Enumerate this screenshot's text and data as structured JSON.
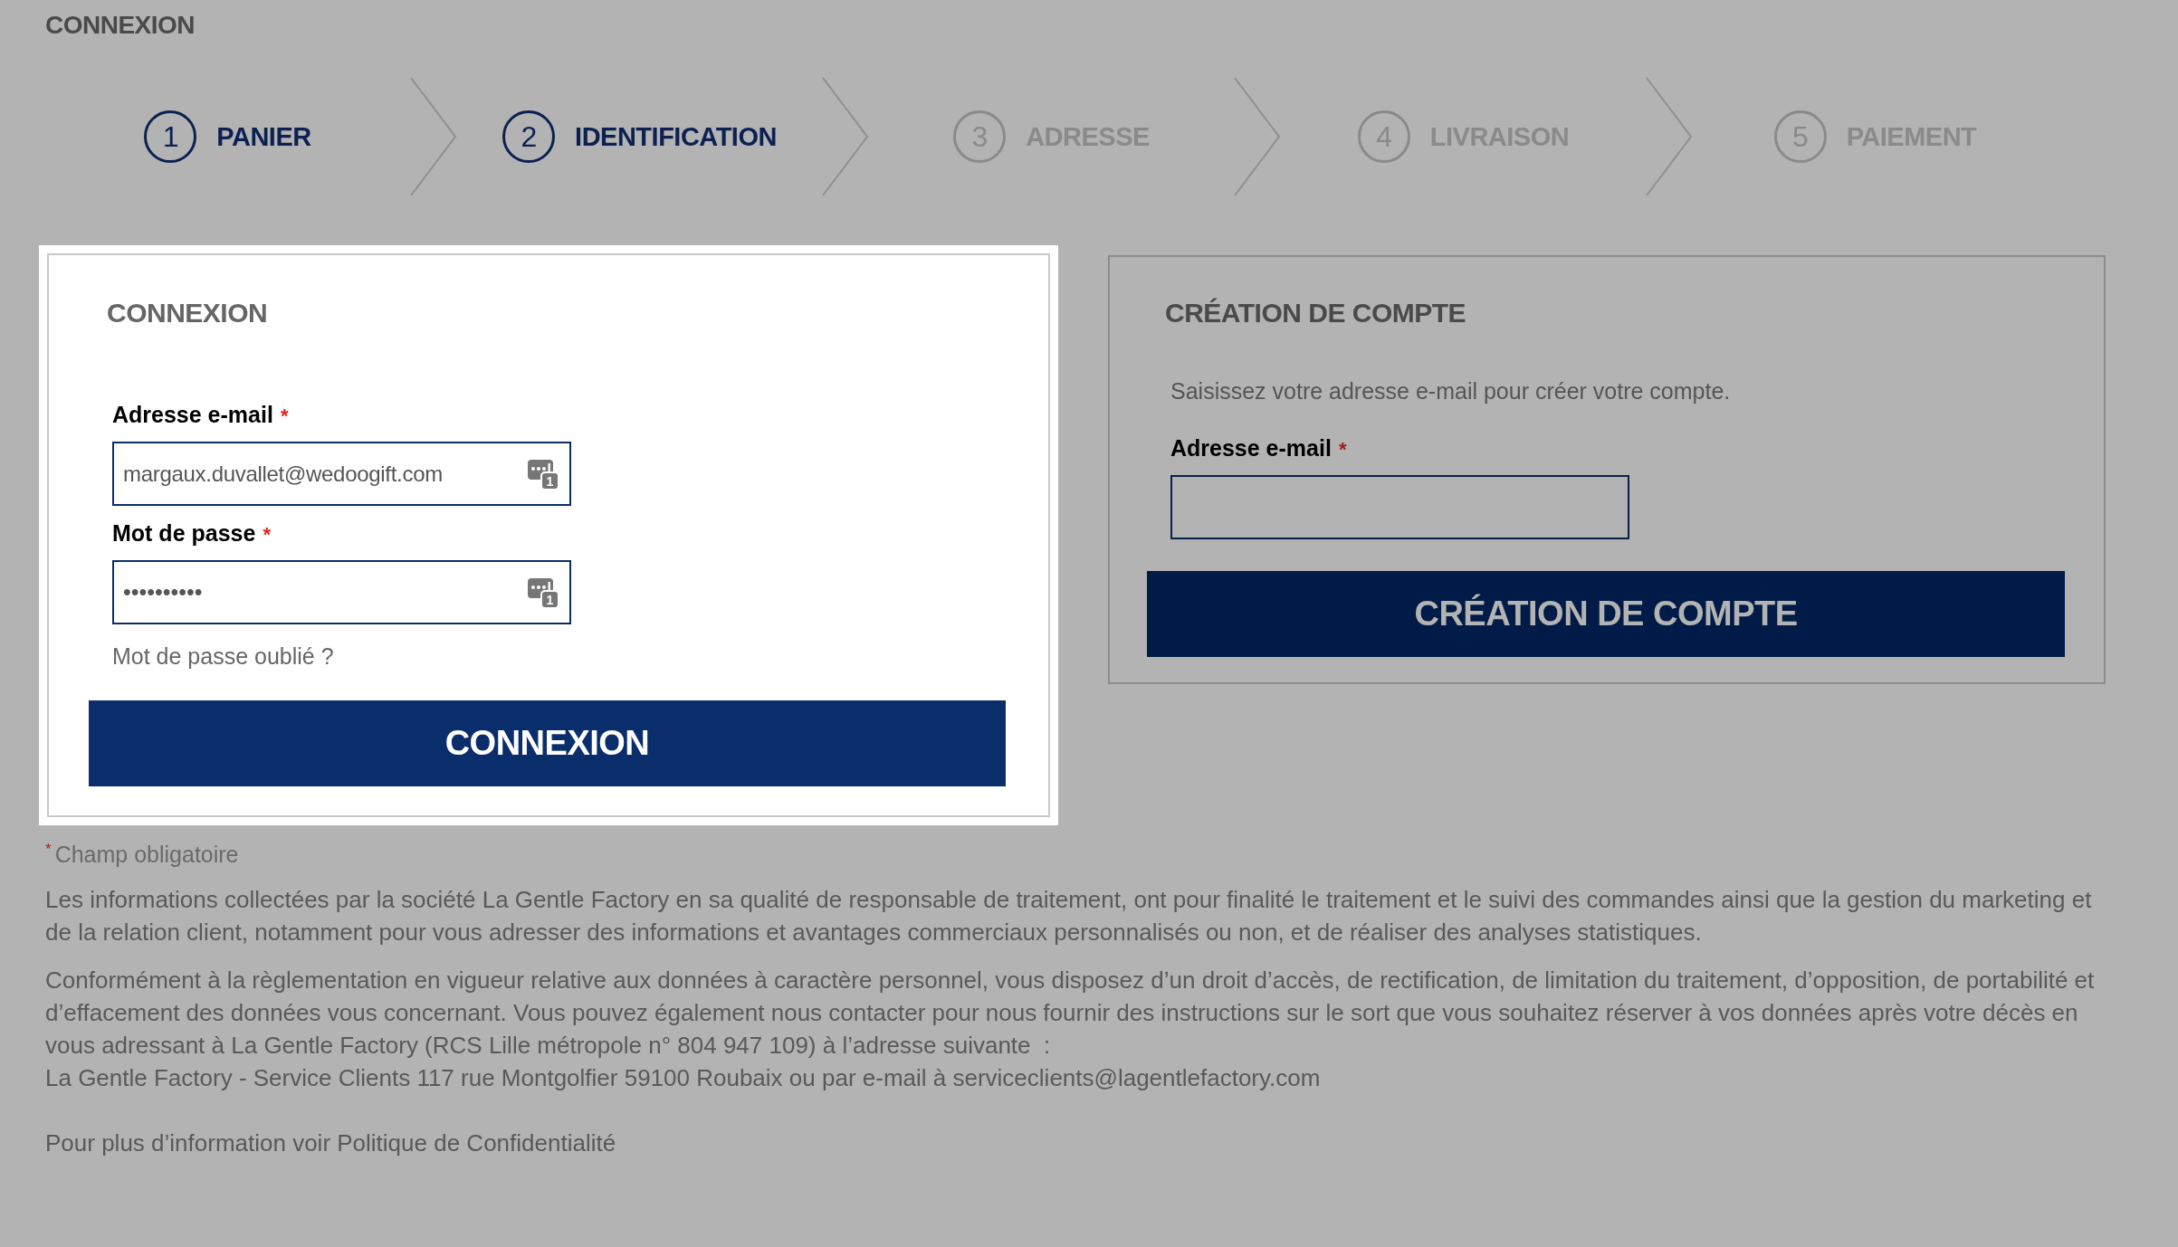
{
  "page_title": "CONNEXION",
  "steps": [
    {
      "number": "1",
      "label": "PANIER",
      "active": true
    },
    {
      "number": "2",
      "label": "IDENTIFICATION",
      "active": true
    },
    {
      "number": "3",
      "label": "ADRESSE",
      "active": false
    },
    {
      "number": "4",
      "label": "LIVRAISON",
      "active": false
    },
    {
      "number": "5",
      "label": "PAIEMENT",
      "active": false
    }
  ],
  "panels": [
    {
      "highlighted": true,
      "title": "CONNEXION",
      "fields": [
        {
          "kind": "email",
          "label": "Adresse e-mail",
          "required_mark": "*",
          "value": "margaux.duvallet@wedoogift.com",
          "autofill_badge": "1"
        },
        {
          "kind": "password",
          "label": "Mot de passe",
          "required_mark": "*",
          "value": "••••••••••",
          "autofill_badge": "1"
        }
      ],
      "forgot_link": "Mot de passe oublié ?",
      "button": "CONNEXION"
    },
    {
      "highlighted": false,
      "title": "CRÉATION DE COMPTE",
      "intro": "Saisissez votre adresse e-mail pour créer votre compte.",
      "fields": [
        {
          "kind": "email",
          "label": "Adresse e-mail",
          "required_mark": "*"
        }
      ],
      "button": "CRÉATION DE COMPTE"
    }
  ],
  "required_note": {
    "mark": "*",
    "text": "Champ obligatoire"
  },
  "legal": [
    "Les informations collectées par la société La Gentle Factory en sa qualité de responsable de traitement, ont pour finalité le traitement et le suivi des commandes ainsi que la gestion du marketing et de la relation client, notamment pour vous adresser des informations et avantages commerciaux personnalisés ou non, et de réaliser des analyses statistiques.",
    "Conformément à la règlementation en vigueur relative aux données à caractère personnel, vous disposez d’un droit d’accès, de rectification, de limitation du traitement, d’opposition, de portabilité et d’effacement des données vous concernant. Vous pouvez également nous contacter pour nous fournir des instructions sur le sort que vous souhaitez réserver à vos données après votre décès en vous adressant à La Gentle Factory (RCS Lille métropole n° 804 947 109) à l’adresse suivante  :\nLa Gentle Factory - Service Clients 117 rue Montgolfier 59100 Roubaix ou par e-mail à serviceclients@lagentlefactory.com"
  ],
  "privacy_note": "Pour plus d’information voir Politique de Confidentialité"
}
